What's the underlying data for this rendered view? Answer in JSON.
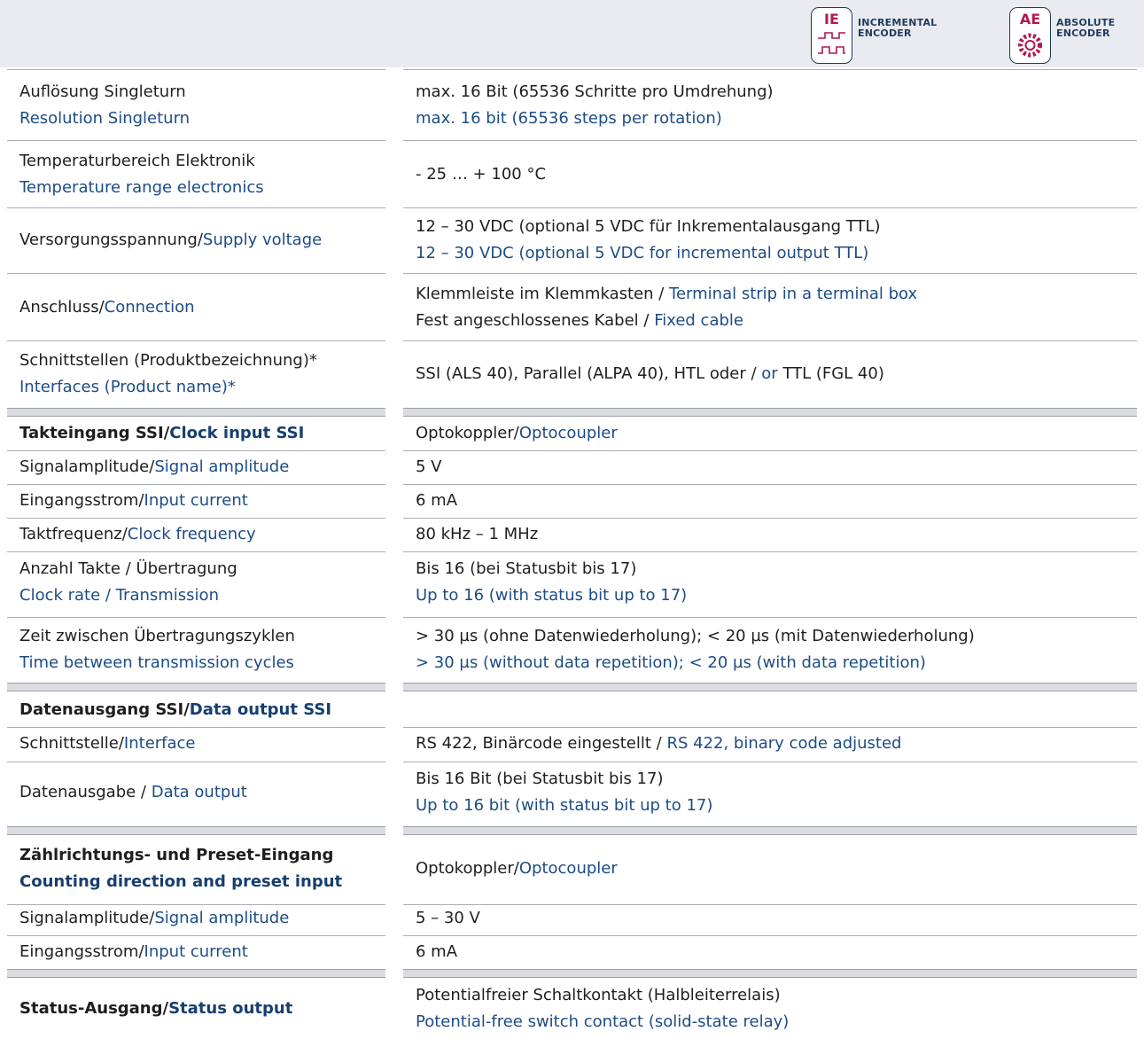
{
  "badges": {
    "ie": {
      "code": "IE",
      "label": "INCREMENTAL\nENCODER",
      "icon": "square-wave-icon"
    },
    "ae": {
      "code": "AE",
      "label": "ABSOLUTE\nENCODER",
      "icon": "encoder-disc-icon"
    }
  },
  "colors": {
    "accent": "#b1194e",
    "english_text": "#1c4c86",
    "header_bg": "#e9ebf1"
  },
  "rows": [
    {
      "de": "Auflösung Singleturn",
      "en": "Resolution Singleturn",
      "v_de": "max. 16 Bit (65536 Schritte pro Umdrehung)",
      "v_en": "max. 16 bit (65536 steps per rotation)"
    },
    {
      "de": "Temperaturbereich Elektronik",
      "en": "Temperature range electronics",
      "v": "- 25 … + 100 °C"
    },
    {
      "label_de": "Versorgungsspannung",
      "label_en": "Supply voltage",
      "v_de": "12 – 30 VDC (optional 5 VDC für Inkrementalausgang TTL)",
      "v_en": "12 – 30 VDC (optional 5 VDC for incremental output TTL)"
    },
    {
      "label_de": "Anschluss",
      "label_en": "Connection",
      "l1_de": "Klemmleiste im Klemmkasten",
      "l1_en": "Terminal strip in a terminal box",
      "l2_de": "Fest angeschlossenes Kabel",
      "l2_en": "Fixed cable"
    },
    {
      "de": "Schnittstellen (Produktbezeichnung)*",
      "en": "Interfaces (Product name)*",
      "v_pre": "SSI (ALS 40), Parallel (ALPA 40), HTL oder",
      "v_en": "or",
      "v_post": "TTL (FGL 40)"
    },
    {
      "label_de": "Takteingang SSI",
      "label_en": "Clock input SSI",
      "v_de": "Optokoppler",
      "v_en": "Optocoupler"
    },
    {
      "label_de": "Signalamplitude",
      "label_en": "Signal amplitude",
      "v": "5 V"
    },
    {
      "label_de": "Eingangsstrom",
      "label_en": "Input current",
      "v": "6 mA"
    },
    {
      "label_de": "Taktfrequenz",
      "label_en": "Clock frequency",
      "v": "80 kHz – 1 MHz"
    },
    {
      "de": "Anzahl Takte / Übertragung",
      "en": "Clock rate / Transmission",
      "v_de": "Bis 16 (bei Statusbit bis 17)",
      "v_en": "Up to 16 (with status bit up to 17)"
    },
    {
      "de": "Zeit zwischen Übertragungszyklen",
      "en": "Time between transmission cycles",
      "v_de": "> 30 µs (ohne Datenwiederholung); < 20 µs (mit Datenwiederholung)",
      "v_en": "> 30 µs (without data repetition); < 20 µs (with data repetition)"
    },
    {
      "label_de": "Datenausgang SSI",
      "label_en": "Data output SSI"
    },
    {
      "label_de": "Schnittstelle",
      "label_en": "Interface",
      "v_de": "RS 422, Binärcode eingestellt",
      "v_en": "RS 422, binary code adjusted"
    },
    {
      "label_de": "Datenausgabe",
      "label_en": "Data output",
      "v_de": "Bis 16 Bit (bei Statusbit bis 17)",
      "v_en": "Up to 16 bit (with status bit up to 17)"
    },
    {
      "de": "Zählrichtungs- und Preset-Eingang",
      "en": "Counting direction and preset input",
      "v_de": "Optokoppler",
      "v_en": "Optocoupler"
    },
    {
      "label_de": "Signalamplitude",
      "label_en": "Signal amplitude",
      "v": "5 – 30 V"
    },
    {
      "label_de": "Eingangsstrom",
      "label_en": "Input current",
      "v": "6 mA"
    },
    {
      "label_de": "Status-Ausgang",
      "label_en": "Status output",
      "v_de": "Potentialfreier Schaltkontakt (Halbleiterrelais)",
      "v_en": "Potential-free switch contact (solid-state relay)"
    }
  ]
}
